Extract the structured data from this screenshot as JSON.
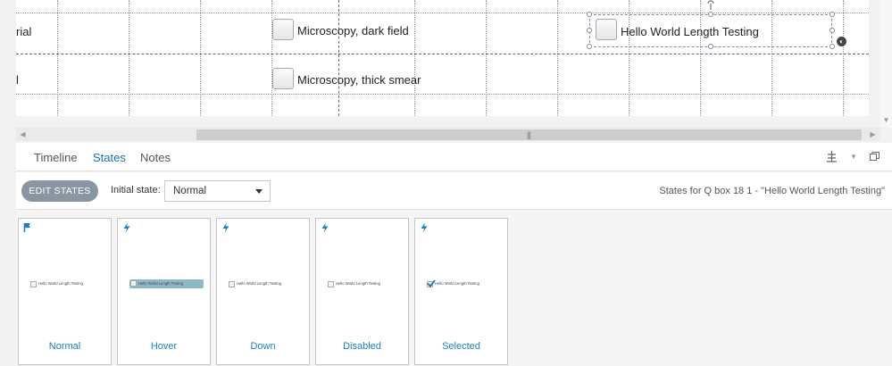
{
  "canvas": {
    "rows": [
      {
        "left_text": "rial",
        "checkbox_label": "Microscopy, dark field"
      },
      {
        "left_text": "l",
        "checkbox_label": "Microscopy, thick smear"
      }
    ],
    "selected_checkbox_label": "Hello World Length Testing"
  },
  "panel": {
    "tabs": [
      "Timeline",
      "States",
      "Notes"
    ],
    "active_tab": "States",
    "toolbar": {
      "edit_states_label": "EDIT STATES",
      "initial_state_label": "Initial state:",
      "initial_state_value": "Normal",
      "states_for_text": "States for Q box 18 1 - \"Hello World Length Testing\""
    },
    "state_cards": [
      {
        "name": "Normal",
        "icon": "flag-icon",
        "thumb_text": "Hello World Length Testing",
        "variant": "normal"
      },
      {
        "name": "Hover",
        "icon": "lightning-icon",
        "thumb_text": "Hello World Length Testing",
        "variant": "hover"
      },
      {
        "name": "Down",
        "icon": "lightning-icon",
        "thumb_text": "Hello World Length Testing",
        "variant": "normal"
      },
      {
        "name": "Disabled",
        "icon": "lightning-icon",
        "thumb_text": "Hello World Length Testing",
        "variant": "normal"
      },
      {
        "name": "Selected",
        "icon": "lightning-icon",
        "thumb_text": "Hello World Length Testing",
        "variant": "selected"
      }
    ]
  },
  "colors": {
    "accent": "#1a7fc0",
    "edit_button": "#8a95a2",
    "hover_highlight": "#8cb8c8"
  }
}
